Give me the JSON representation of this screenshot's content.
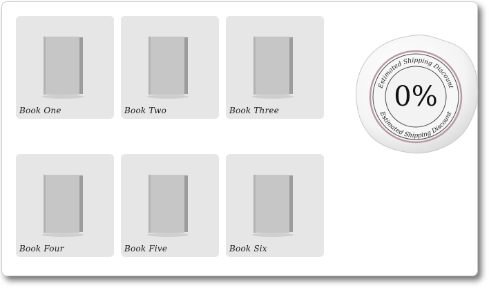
{
  "books": [
    {
      "title": "Book One"
    },
    {
      "title": "Book Two"
    },
    {
      "title": "Book Three"
    },
    {
      "title": "Book Four"
    },
    {
      "title": "Book Five"
    },
    {
      "title": "Book Six"
    }
  ],
  "seal": {
    "ring_text_top": "Estimated Shipping Discount",
    "ring_text_bottom": "Estimated Shipping Discount",
    "value": "0%"
  }
}
